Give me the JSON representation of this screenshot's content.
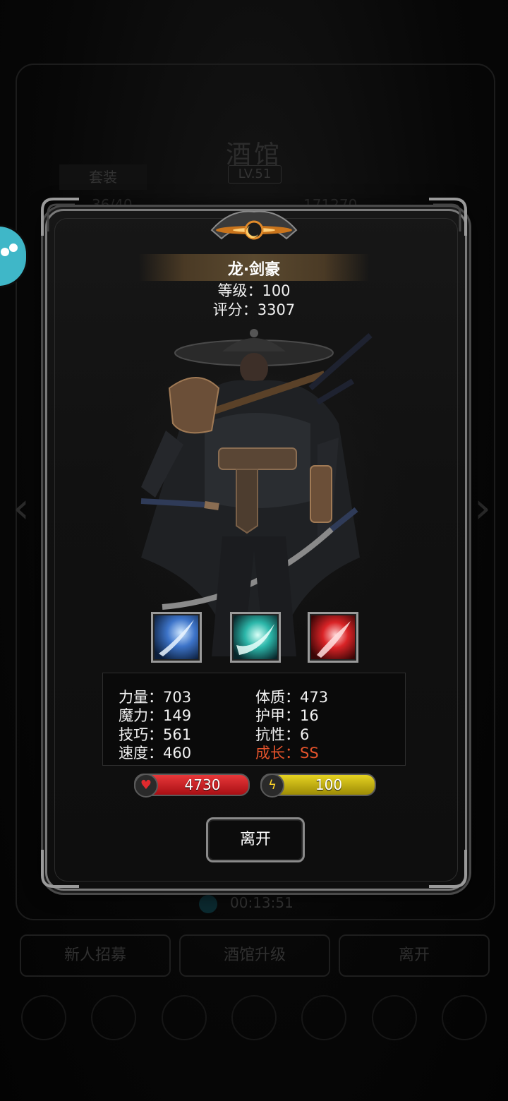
{
  "background": {
    "title": "酒馆",
    "level": "LV.51",
    "tab": "套装",
    "capacity_left": "36/40",
    "capacity_right": "171270",
    "timer": "00:13:51",
    "buttons": [
      "新人招募",
      "酒馆升级",
      "离开"
    ]
  },
  "dialog": {
    "hero_name": "龙·剑豪",
    "level_text": "等级：100",
    "score_text": "评分：3307",
    "skills": [
      "blue-slash-skill-icon",
      "cyan-slash-skill-icon",
      "red-slash-skill-icon"
    ],
    "stats": {
      "strength": "力量：703",
      "constitution": "体质：473",
      "magic": "魔力：149",
      "armor": "护甲：16",
      "skill": "技巧：561",
      "resistance": "抗性：6",
      "speed": "速度：460",
      "growth": "成长：SS"
    },
    "hp": "4730",
    "energy": "100",
    "leave_label": "离开"
  },
  "colors": {
    "growth": "#e5532b",
    "hp": "#d8262a",
    "energy": "#d8c414",
    "name_bar": "#5b4a30"
  }
}
